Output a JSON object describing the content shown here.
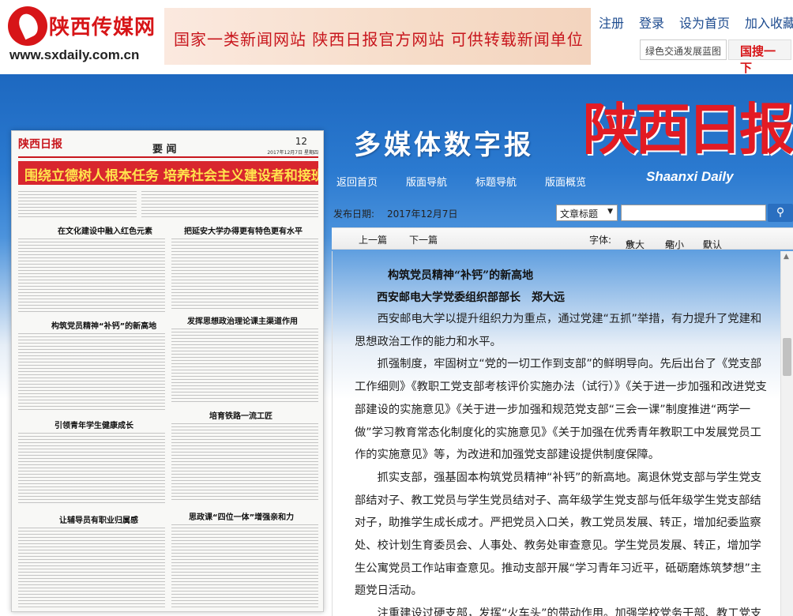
{
  "header": {
    "logo_name": "陕西传媒网",
    "logo_url": "www.sxdaily.com.cn",
    "banner_text": "国家一类新闻网站  陕西日报官方网站  可供转载新闻单位",
    "links": [
      "注册",
      "登录",
      "设为首页",
      "加入收藏"
    ],
    "search_text": "绿色交通发展蓝图",
    "search_button": "国搜一下"
  },
  "hero": {
    "title": "多媒体数字报",
    "brand": "陕西日报",
    "brand_en": "Shaanxi Daily",
    "nav": [
      "返回首页",
      "版面导航",
      "标题导航",
      "版面概览"
    ]
  },
  "paper": {
    "logo": "陕西日报",
    "section": "要 闻",
    "page_no": "12",
    "date": "2017年12月7日 星期四",
    "headline": "围绕立德树人根本任务 培养社会主义建设者和接班人",
    "articles": [
      "在文化建设中融入红色元素",
      "把延安大学办得更有特色更有水平",
      "构筑党员精神“补钙”的新高地",
      "发挥思想政治理论课主渠道作用",
      "培育铁路一流工匠",
      "引领青年学生健康成长",
      "思政课“四位一体”增强亲和力",
      "让辅导员有职业归属感"
    ]
  },
  "toolbar": {
    "date_label": "发布日期:",
    "date_value": "2017年12月7日",
    "select_value": "文章标题",
    "prev": "上一篇",
    "next": "下一篇",
    "font_label": "字体:",
    "zoom_in": "放大",
    "zoom_out": "缩小",
    "default": "默认"
  },
  "article": {
    "title": "构筑党员精神“补钙”的新高地",
    "author": "西安邮电大学党委组织部部长　郑大远",
    "paragraphs": [
      "西安邮电大学以提升组织力为重点，通过党建“五抓”举措，有力提升了党建和思想政治工作的能力和水平。",
      "抓强制度，牢固树立“党的一切工作到支部”的鲜明导向。先后出台了《党支部工作细则》《教职工党支部考核评价实施办法（试行）》《关于进一步加强和改进党支部建设的实施意见》《关于进一步加强和规范党支部“三会一课”制度推进“两学一做”学习教育常态化制度化的实施意见》《关于加强在优秀青年教职工中发展党员工作的实施意见》等，为改进和加强党支部建设提供制度保障。",
      "抓实支部，强基固本构筑党员精神“补钙”的新高地。离退休党支部与学生党支部结对子、教工党员与学生党员结对子、高年级学生党支部与低年级学生党支部结对子，助推学生成长成才。严把党员入口关，教工党员发展、转正，增加纪委监察处、校计划生育委员会、人事处、教务处审查意见。学生党员发展、转正，增加学生公寓党员工作站审查意见。推动支部开展“学习青年习近平，砥砺磨炼筑梦想”主题党日活动。",
      "注重建设过硬支部，发挥“火车头”的带动作用。加强学校党务干部、教工党支"
    ]
  },
  "colors": {
    "brand_red": "#d71518",
    "nav_blue": "#1d68c0",
    "link_blue": "#1d4b8f"
  }
}
